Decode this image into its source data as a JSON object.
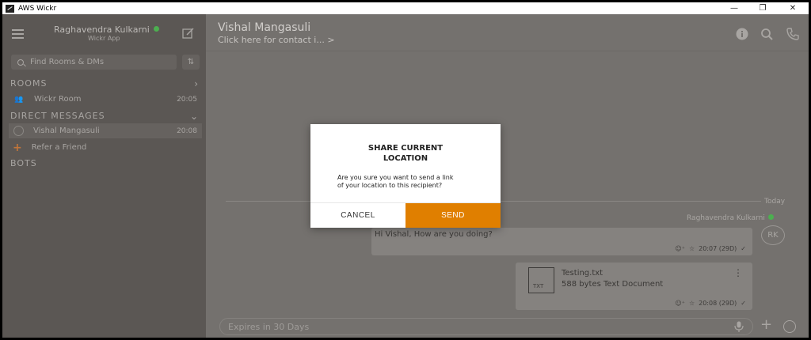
{
  "window": {
    "title": "AWS Wickr",
    "minimize": "—",
    "restore": "❐",
    "close": "✕"
  },
  "sidebar": {
    "user_name": "Raghavendra Kulkarni",
    "user_sub": "Wickr App",
    "search_placeholder": "Find Rooms & DMs",
    "sort_label": "⇅",
    "rooms_header": "ROOMS",
    "rooms": [
      {
        "label": "Wickr Room",
        "time": "20:05"
      }
    ],
    "dm_header": "DIRECT MESSAGES",
    "dms": [
      {
        "label": "Vishal Mangasuli",
        "time": "20:08"
      }
    ],
    "refer_label": "Refer a Friend",
    "bots_header": "BOTS"
  },
  "chat": {
    "contact_name": "Vishal Mangasuli",
    "contact_sub": "Click here for contact i... >",
    "day_label": "Today",
    "sender": "Raghavendra Kulkarni",
    "avatar_initials": "RK",
    "messages": [
      {
        "text": "Hi Vishal, How are you doing?",
        "time": "20:07 (29D)"
      },
      {
        "file_type": "TXT",
        "file_name": "Testing.txt",
        "file_size": "588 bytes Text Document",
        "time": "20:08 (29D)"
      }
    ],
    "composer_placeholder": "Expires in 30 Days"
  },
  "modal": {
    "title": "SHARE CURRENT\nLOCATION",
    "body": "Are you sure you want to send a link\nof your location to this recipient?",
    "cancel_label": "CANCEL",
    "send_label": "SEND"
  },
  "colors": {
    "accent": "#e07f00",
    "online": "#4caf50",
    "sidebar_bg": "#5b5754",
    "chat_bg": "#74716e"
  }
}
